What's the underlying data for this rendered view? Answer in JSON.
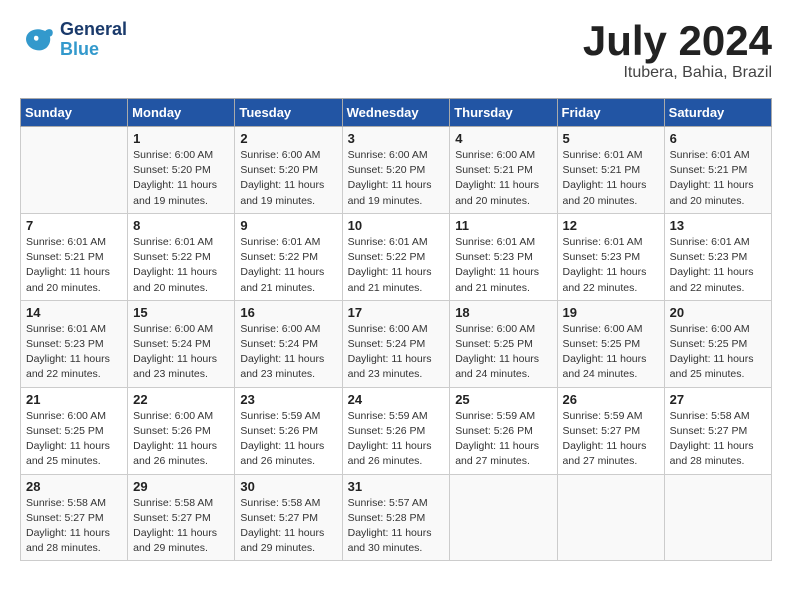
{
  "header": {
    "logo_general": "General",
    "logo_blue": "Blue",
    "month_title": "July 2024",
    "location": "Itubera, Bahia, Brazil"
  },
  "columns": [
    "Sunday",
    "Monday",
    "Tuesday",
    "Wednesday",
    "Thursday",
    "Friday",
    "Saturday"
  ],
  "weeks": [
    [
      {
        "day": "",
        "info": ""
      },
      {
        "day": "1",
        "info": "Sunrise: 6:00 AM\nSunset: 5:20 PM\nDaylight: 11 hours\nand 19 minutes."
      },
      {
        "day": "2",
        "info": "Sunrise: 6:00 AM\nSunset: 5:20 PM\nDaylight: 11 hours\nand 19 minutes."
      },
      {
        "day": "3",
        "info": "Sunrise: 6:00 AM\nSunset: 5:20 PM\nDaylight: 11 hours\nand 19 minutes."
      },
      {
        "day": "4",
        "info": "Sunrise: 6:00 AM\nSunset: 5:21 PM\nDaylight: 11 hours\nand 20 minutes."
      },
      {
        "day": "5",
        "info": "Sunrise: 6:01 AM\nSunset: 5:21 PM\nDaylight: 11 hours\nand 20 minutes."
      },
      {
        "day": "6",
        "info": "Sunrise: 6:01 AM\nSunset: 5:21 PM\nDaylight: 11 hours\nand 20 minutes."
      }
    ],
    [
      {
        "day": "7",
        "info": "Sunrise: 6:01 AM\nSunset: 5:21 PM\nDaylight: 11 hours\nand 20 minutes."
      },
      {
        "day": "8",
        "info": "Sunrise: 6:01 AM\nSunset: 5:22 PM\nDaylight: 11 hours\nand 20 minutes."
      },
      {
        "day": "9",
        "info": "Sunrise: 6:01 AM\nSunset: 5:22 PM\nDaylight: 11 hours\nand 21 minutes."
      },
      {
        "day": "10",
        "info": "Sunrise: 6:01 AM\nSunset: 5:22 PM\nDaylight: 11 hours\nand 21 minutes."
      },
      {
        "day": "11",
        "info": "Sunrise: 6:01 AM\nSunset: 5:23 PM\nDaylight: 11 hours\nand 21 minutes."
      },
      {
        "day": "12",
        "info": "Sunrise: 6:01 AM\nSunset: 5:23 PM\nDaylight: 11 hours\nand 22 minutes."
      },
      {
        "day": "13",
        "info": "Sunrise: 6:01 AM\nSunset: 5:23 PM\nDaylight: 11 hours\nand 22 minutes."
      }
    ],
    [
      {
        "day": "14",
        "info": "Sunrise: 6:01 AM\nSunset: 5:23 PM\nDaylight: 11 hours\nand 22 minutes."
      },
      {
        "day": "15",
        "info": "Sunrise: 6:00 AM\nSunset: 5:24 PM\nDaylight: 11 hours\nand 23 minutes."
      },
      {
        "day": "16",
        "info": "Sunrise: 6:00 AM\nSunset: 5:24 PM\nDaylight: 11 hours\nand 23 minutes."
      },
      {
        "day": "17",
        "info": "Sunrise: 6:00 AM\nSunset: 5:24 PM\nDaylight: 11 hours\nand 23 minutes."
      },
      {
        "day": "18",
        "info": "Sunrise: 6:00 AM\nSunset: 5:25 PM\nDaylight: 11 hours\nand 24 minutes."
      },
      {
        "day": "19",
        "info": "Sunrise: 6:00 AM\nSunset: 5:25 PM\nDaylight: 11 hours\nand 24 minutes."
      },
      {
        "day": "20",
        "info": "Sunrise: 6:00 AM\nSunset: 5:25 PM\nDaylight: 11 hours\nand 25 minutes."
      }
    ],
    [
      {
        "day": "21",
        "info": "Sunrise: 6:00 AM\nSunset: 5:25 PM\nDaylight: 11 hours\nand 25 minutes."
      },
      {
        "day": "22",
        "info": "Sunrise: 6:00 AM\nSunset: 5:26 PM\nDaylight: 11 hours\nand 26 minutes."
      },
      {
        "day": "23",
        "info": "Sunrise: 5:59 AM\nSunset: 5:26 PM\nDaylight: 11 hours\nand 26 minutes."
      },
      {
        "day": "24",
        "info": "Sunrise: 5:59 AM\nSunset: 5:26 PM\nDaylight: 11 hours\nand 26 minutes."
      },
      {
        "day": "25",
        "info": "Sunrise: 5:59 AM\nSunset: 5:26 PM\nDaylight: 11 hours\nand 27 minutes."
      },
      {
        "day": "26",
        "info": "Sunrise: 5:59 AM\nSunset: 5:27 PM\nDaylight: 11 hours\nand 27 minutes."
      },
      {
        "day": "27",
        "info": "Sunrise: 5:58 AM\nSunset: 5:27 PM\nDaylight: 11 hours\nand 28 minutes."
      }
    ],
    [
      {
        "day": "28",
        "info": "Sunrise: 5:58 AM\nSunset: 5:27 PM\nDaylight: 11 hours\nand 28 minutes."
      },
      {
        "day": "29",
        "info": "Sunrise: 5:58 AM\nSunset: 5:27 PM\nDaylight: 11 hours\nand 29 minutes."
      },
      {
        "day": "30",
        "info": "Sunrise: 5:58 AM\nSunset: 5:27 PM\nDaylight: 11 hours\nand 29 minutes."
      },
      {
        "day": "31",
        "info": "Sunrise: 5:57 AM\nSunset: 5:28 PM\nDaylight: 11 hours\nand 30 minutes."
      },
      {
        "day": "",
        "info": ""
      },
      {
        "day": "",
        "info": ""
      },
      {
        "day": "",
        "info": ""
      }
    ]
  ]
}
